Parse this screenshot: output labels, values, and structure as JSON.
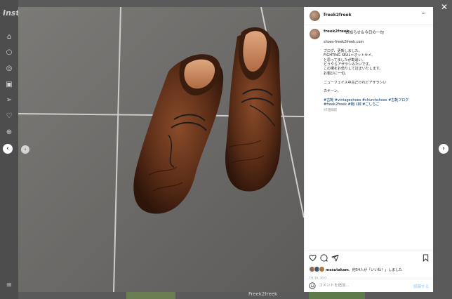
{
  "background": {
    "logo_text": "Inst",
    "sidebar_icons": [
      "home-icon",
      "search-icon",
      "explore-icon",
      "reels-icon",
      "messages-icon",
      "heart-icon",
      "create-icon",
      "profile-icon",
      "menu-icon"
    ],
    "bottom_label": "Freek2freek"
  },
  "post": {
    "username": "freek2freek",
    "more_label": "···",
    "caption_title": "お知らせ＆今日の一句",
    "caption_lines": [
      "shoes-freek2freek.com",
      "",
      "ブログ、更新しました。",
      "FIGHTING SEAL＝オットセイ、",
      "と思ってましたが勘違い。",
      "どうやらアザラシみたいです。",
      "この場をお借りして訂正いたします。",
      "お粗びに一句。",
      "",
      "ニューフェイス中古だけれどアザラシい",
      "",
      "カキーン。",
      ""
    ],
    "hashtags": [
      "#古靴 #vintageshoes #churchshoes #古靴ブログ",
      "#freek2freek #靴川柳 #ごしちご"
    ],
    "caption_time": "97週間前",
    "likes_text_user": "masutakam",
    "likes_text_rest": "、他54人が「いいね！」しました",
    "date": "7月 20, 2021",
    "comment_placeholder": "コメントを追加...",
    "post_label": "投稿する"
  },
  "controls": {
    "close_label": "✕",
    "prev_label": "‹",
    "next_label": "›",
    "photo_prev_label": "‹"
  },
  "colors": {
    "link": "#00376b",
    "post_button": "#b3dbff",
    "overlay": "#2a2a2a"
  }
}
